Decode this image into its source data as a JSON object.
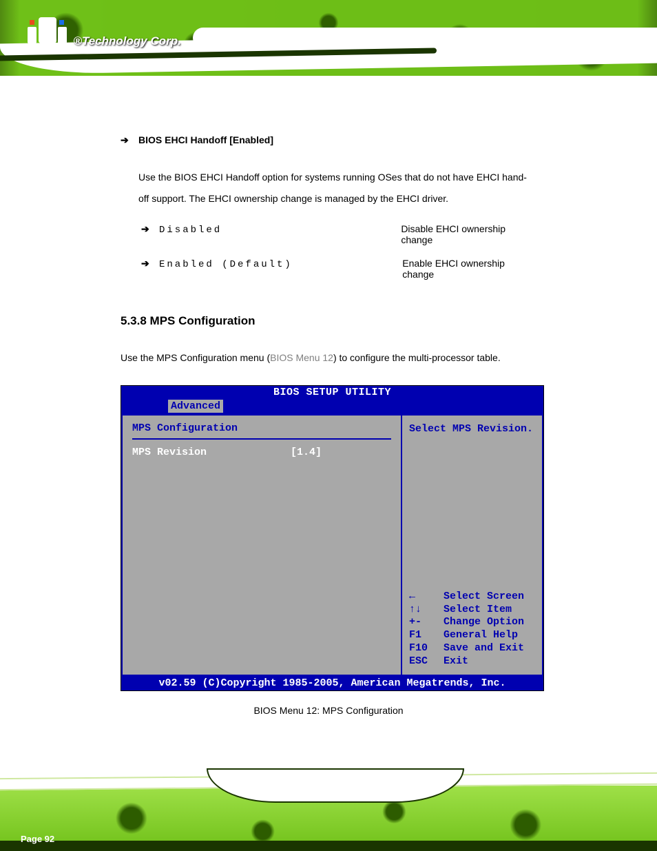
{
  "header": {
    "logo_text": "®Technology Corp."
  },
  "section_option": {
    "label": "BIOS EHCI Handoff [Enabled]",
    "para": "Use the BIOS EHCI Handoff option for systems running OSes that do not have EHCI hand-off support. The EHCI ownership change is managed by the EHCI driver.",
    "options": [
      {
        "label": "Disabled",
        "desc": "Disable EHCI ownership change"
      },
      {
        "label": "Enabled      (Default)",
        "desc": "Enable EHCI ownership change"
      }
    ]
  },
  "section_heading": "5.3.8 MPS Configuration",
  "section_para_prefix": "Use the MPS Configuration menu (",
  "section_para_ref": "BIOS Menu 12",
  "section_para_suffix": ") to configure the multi-processor table.",
  "bios": {
    "title": "BIOS SETUP UTILITY",
    "tab": "Advanced",
    "left_title": "MPS Configuration",
    "setting_label": "MPS Revision",
    "setting_value": "[1.4]",
    "help_top": "Select MPS Revision.",
    "help_keys": [
      {
        "key": "←",
        "action": "Select Screen"
      },
      {
        "key": "↑↓",
        "action": "Select Item"
      },
      {
        "key": "+-",
        "action": "Change Option"
      },
      {
        "key": "F1",
        "action": "General Help"
      },
      {
        "key": "F10",
        "action": "Save and Exit"
      },
      {
        "key": "ESC",
        "action": "Exit"
      }
    ],
    "footer": "v02.59 (C)Copyright 1985-2005, American Megatrends, Inc.",
    "caption": "BIOS Menu 12: MPS Configuration"
  },
  "page_number": "Page 92"
}
